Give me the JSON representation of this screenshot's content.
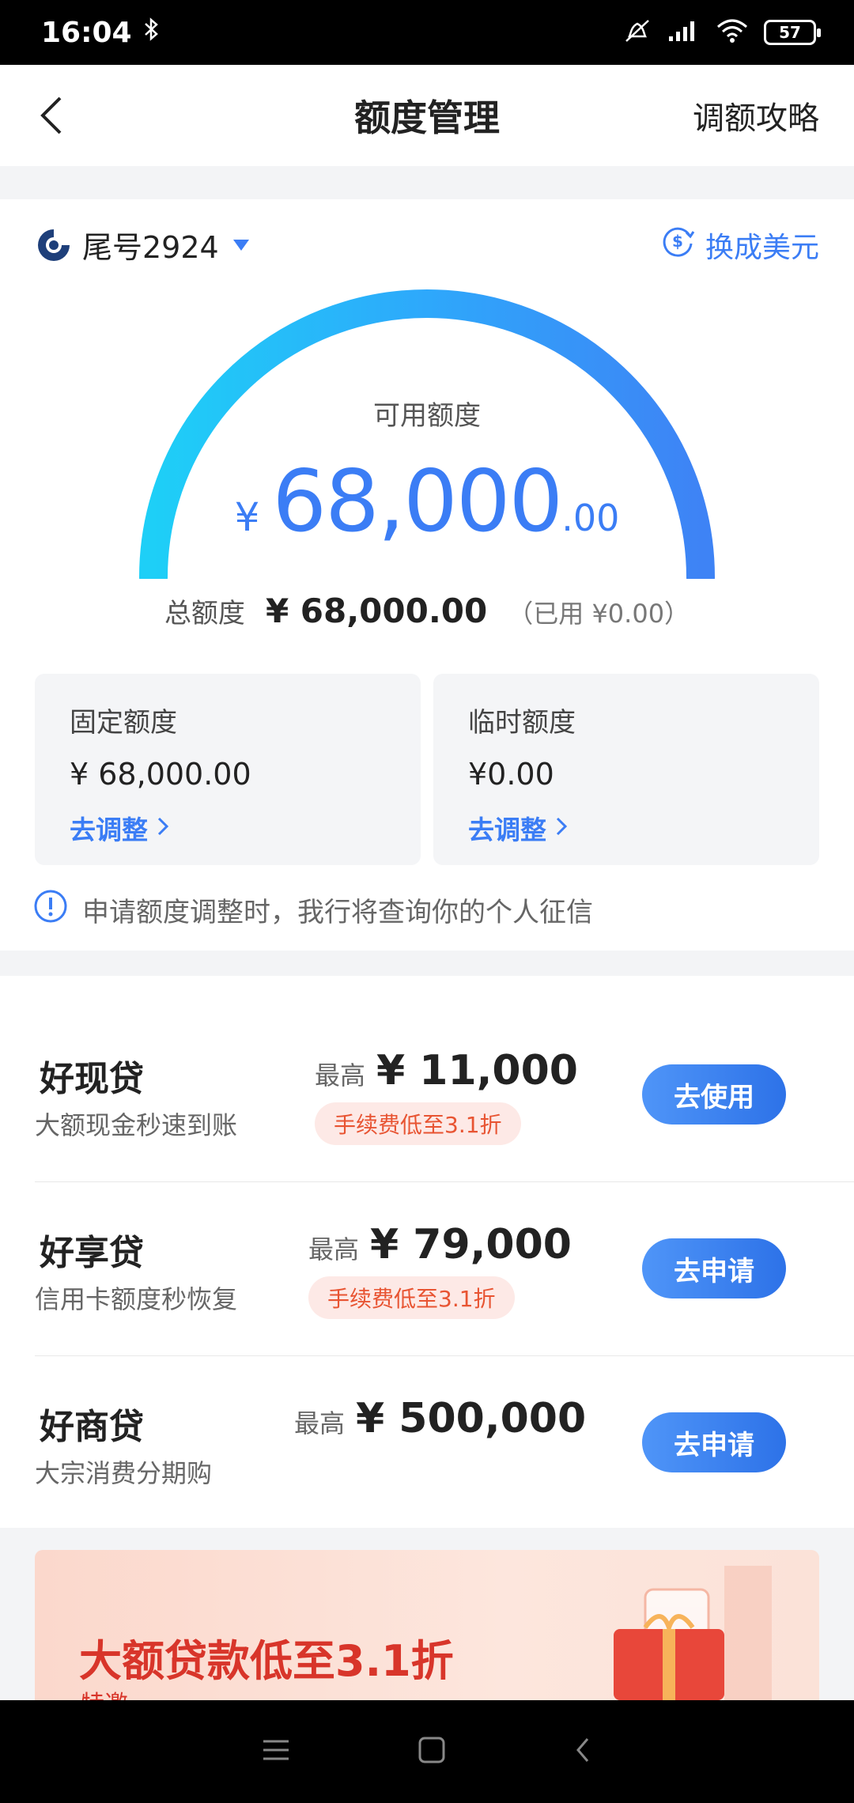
{
  "status_bar": {
    "time": "16:04",
    "battery": "57"
  },
  "header": {
    "title": "额度管理",
    "right_link": "调额攻略"
  },
  "card": {
    "tail_number": "尾号2924",
    "currency_switch": "换成美元",
    "available_label": "可用额度",
    "available_symbol": "¥",
    "available_int": "68,000",
    "available_cents": ".00",
    "total_label": "总额度",
    "total_amount": "¥ 68,000.00",
    "used_text": "（已用 ¥0.00）",
    "gauge_fraction": 1.0
  },
  "fixed_quota": {
    "label": "固定额度",
    "value": "¥ 68,000.00",
    "link": "去调整"
  },
  "temp_quota": {
    "label": "临时额度",
    "value": "¥0.00",
    "link": "去调整"
  },
  "notice": "申请额度调整时，我行将查询你的个人征信",
  "loans": [
    {
      "name": "好现贷",
      "desc": "大额现金秒速到账",
      "max_label": "最高",
      "max_value": "¥ 11,000",
      "fee_tag": "手续费低至3.1折",
      "button": "去使用"
    },
    {
      "name": "好享贷",
      "desc": "信用卡额度秒恢复",
      "max_label": "最高",
      "max_value": "¥ 79,000",
      "fee_tag": "手续费低至3.1折",
      "button": "去申请"
    },
    {
      "name": "好商贷",
      "desc": "大宗消费分期购",
      "max_label": "最高",
      "max_value": "¥ 500,000",
      "button": "去申请"
    }
  ],
  "banner": {
    "title": "大额贷款低至3.1折",
    "subtitle": "特邀"
  },
  "colors": {
    "accent": "#3b7df5",
    "tag_red": "#e85432"
  }
}
